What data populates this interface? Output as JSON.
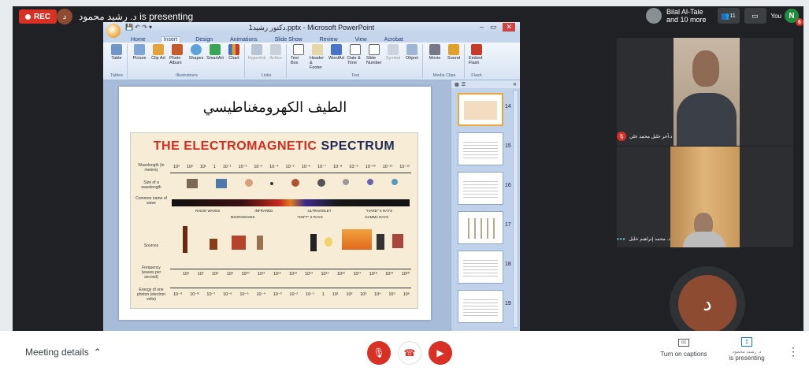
{
  "topbar": {
    "rec_label": "REC",
    "presenter_initial": "د",
    "presenting_text": "د. رشيد محمود is presenting",
    "people_name": "Bilal Al-Taie",
    "people_more": "and 10 more",
    "people_count": "11",
    "you_label": "You",
    "you_initial": "N",
    "notification_count": "6"
  },
  "ppt": {
    "window_title": "دكتور رشيد1.pptx - Microsoft PowerPoint",
    "tabs": [
      "Home",
      "Insert",
      "Design",
      "Animations",
      "Slide Show",
      "Review",
      "View",
      "Acrobat"
    ],
    "active_tab": "Insert",
    "ribbon_groups": [
      {
        "label": "Tables",
        "buttons": [
          "Table"
        ]
      },
      {
        "label": "Illustrations",
        "buttons": [
          "Picture",
          "Clip Art",
          "Photo Album",
          "Shapes",
          "SmartArt",
          "Chart"
        ]
      },
      {
        "label": "Links",
        "buttons": [
          "Hyperlink",
          "Action"
        ]
      },
      {
        "label": "Text",
        "buttons": [
          "Text Box",
          "Header & Footer",
          "WordArt",
          "Date & Time",
          "Slide Number",
          "Symbol",
          "Object"
        ]
      },
      {
        "label": "Media Clips",
        "buttons": [
          "Movie",
          "Sound"
        ]
      },
      {
        "label": "Flash",
        "buttons": [
          "Embed Flash"
        ]
      }
    ],
    "slide_title": "الطيف الكهرومغناطيسي",
    "slide_heading_a": "THE ELECTROMAGNETIC",
    "slide_heading_b": "SPECTRUM",
    "row_labels": [
      "Wavelength (in meters)",
      "Size of a wavelength",
      "Common name of wave",
      "Sources",
      "Frequency (waves per second)",
      "Energy of one photon (electron volts)"
    ],
    "wavelength_ticks": [
      "10³",
      "10²",
      "10¹",
      "1",
      "10⁻¹",
      "10⁻²",
      "10⁻³",
      "10⁻⁴",
      "10⁻⁵",
      "10⁻⁶",
      "10⁻⁷",
      "10⁻⁸",
      "10⁻⁹",
      "10⁻¹⁰",
      "10⁻¹¹",
      "10⁻¹²"
    ],
    "frequency_ticks": [
      "10⁶",
      "10⁷",
      "10⁸",
      "10⁹",
      "10¹⁰",
      "10¹¹",
      "10¹²",
      "10¹³",
      "10¹⁴",
      "10¹⁵",
      "10¹⁶",
      "10¹⁷",
      "10¹⁸",
      "10¹⁹",
      "10²⁰"
    ],
    "energy_ticks": [
      "10⁻⁹",
      "10⁻⁸",
      "10⁻⁷",
      "10⁻⁶",
      "10⁻⁵",
      "10⁻⁴",
      "10⁻³",
      "10⁻²",
      "10⁻¹",
      "1",
      "10¹",
      "10²",
      "10³",
      "10⁴",
      "10⁵",
      "10⁶"
    ],
    "wave_names": [
      "RADIO WAVES",
      "INFRARED",
      "ULTRAVIOLET",
      "\"HARD\" X RAYS",
      "MICROWAVES",
      "\"SOFT\" X RAYS",
      "GAMMA RAYS"
    ],
    "thumb_numbers": [
      "14",
      "15",
      "16",
      "17",
      "18",
      "19"
    ]
  },
  "participants": {
    "tile1_name": "د.آخر خليل محمد علي",
    "tile2_name": "د. محمد إبراهيم خليل",
    "avatar_initial": "د"
  },
  "bottombar": {
    "meeting_details": "Meeting details",
    "captions_label": "Turn on captions",
    "presenting_name": "د. رشيد محمود",
    "presenting_label": "is presenting"
  },
  "colors": {
    "end_call": "#d93025",
    "meet_bg": "#202124",
    "ppt_title_red": "#d62b1e"
  }
}
